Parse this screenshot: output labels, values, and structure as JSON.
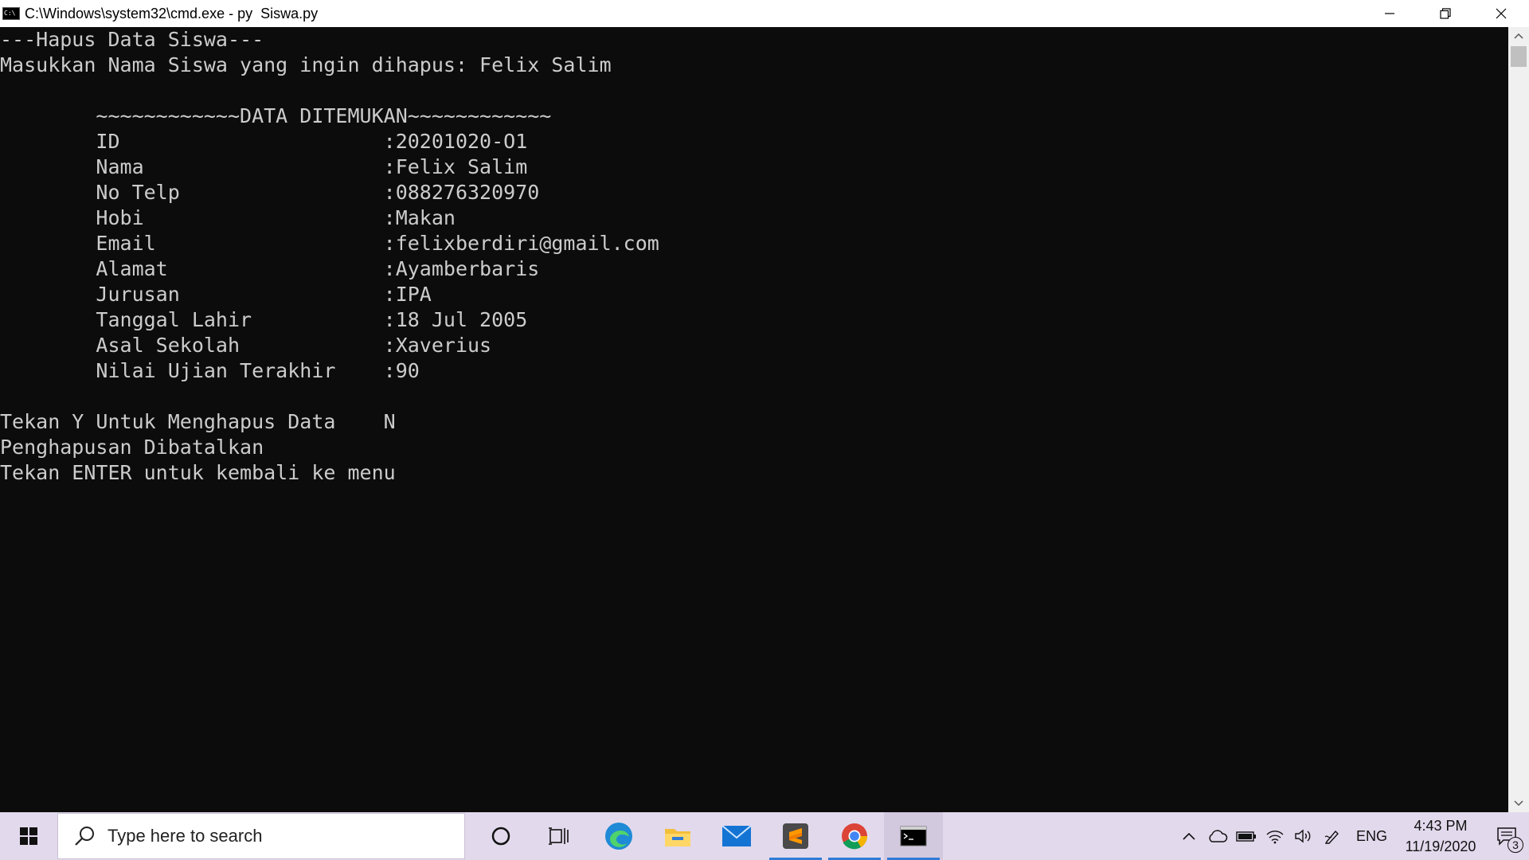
{
  "window": {
    "title": "C:\\Windows\\system32\\cmd.exe - py  Siswa.py",
    "icon": "cmd-icon",
    "icon_text": "C:\\"
  },
  "console": {
    "lines": [
      "---Hapus Data Siswa---",
      "Masukkan Nama Siswa yang ingin dihapus: Felix Salim",
      "",
      "        ~~~~~~~~~~~~DATA DITEMUKAN~~~~~~~~~~~~",
      "        ID                      :20201020-O1",
      "        Nama                    :Felix Salim",
      "        No Telp                 :088276320970",
      "        Hobi                    :Makan",
      "        Email                   :felixberdiri@gmail.com",
      "        Alamat                  :Ayamberbaris",
      "        Jurusan                 :IPA",
      "        Tanggal Lahir           :18 Jul 2005",
      "        Asal Sekolah            :Xaverius",
      "        Nilai Ujian Terakhir    :90",
      "",
      "Tekan Y Untuk Menghapus Data    N",
      "Penghapusan Dibatalkan",
      "Tekan ENTER untuk kembali ke menu"
    ]
  },
  "taskbar": {
    "search_placeholder": "Type here to search",
    "apps": [
      "cortana-icon",
      "task-view-icon",
      "edge-icon",
      "file-explorer-icon",
      "mail-icon",
      "sublime-text-icon",
      "chrome-icon",
      "cmd-icon"
    ],
    "tray": {
      "language": "ENG",
      "time": "4:43 PM",
      "date": "11/19/2020",
      "notification_count": "3"
    }
  },
  "colors": {
    "console_bg": "#0c0c0c",
    "console_fg": "#cccccc",
    "taskbar_bg": "#e2d9ec",
    "accent": "#2f7bd6"
  }
}
